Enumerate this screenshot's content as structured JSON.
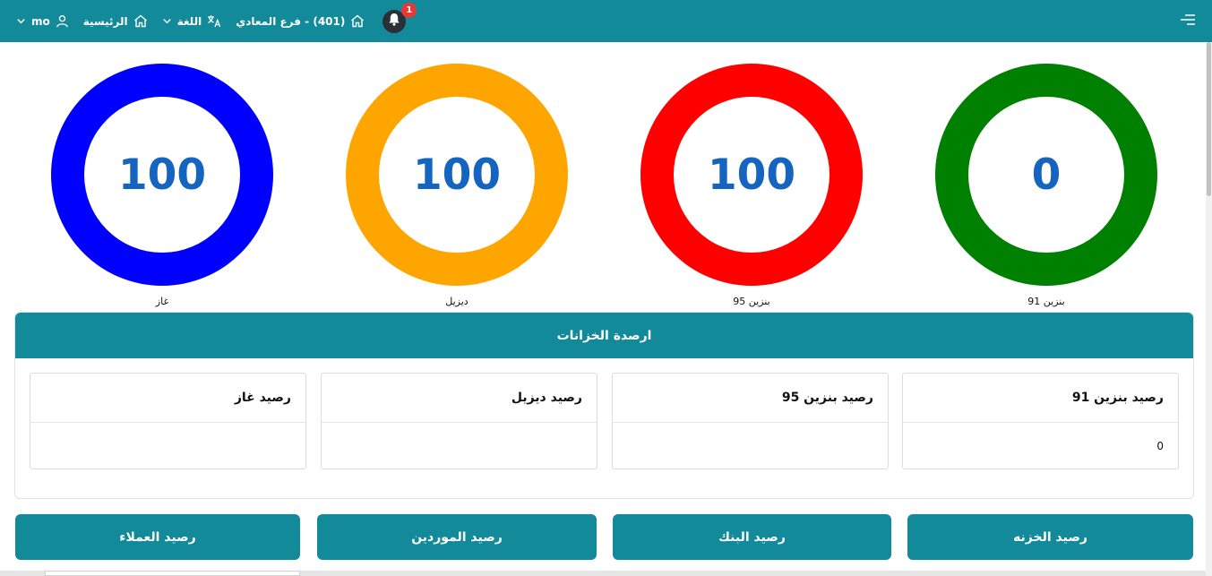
{
  "topbar": {
    "user": "mo",
    "home_label": "الرئيسية",
    "language_label": "اللغة",
    "branch_label": "(401) - فرع المعادي",
    "notification_count": "1",
    "bg_color": "#138a9a"
  },
  "gauges": [
    {
      "value": "100",
      "label": "غاز",
      "color": "#0000ff"
    },
    {
      "value": "100",
      "label": "ديزيل",
      "color": "#ffa500"
    },
    {
      "value": "100",
      "label": "بنزين 95",
      "color": "#ff0000"
    },
    {
      "value": "0",
      "label": "بنزين 91",
      "color": "#008000"
    }
  ],
  "tanks": {
    "title": "ارصدة الخزانات",
    "cards": [
      {
        "title": "رصيد غاز",
        "value": ""
      },
      {
        "title": "رصيد ديزيل",
        "value": ""
      },
      {
        "title": "رصيد بنزين 95",
        "value": ""
      },
      {
        "title": "رصيد بنزين 91",
        "value": "0"
      }
    ]
  },
  "balances": [
    {
      "title": "رصيد العملاء"
    },
    {
      "title": "رصيد الموردين"
    },
    {
      "title": "رصيد البنك"
    },
    {
      "title": "رصيد الخزنه"
    }
  ]
}
